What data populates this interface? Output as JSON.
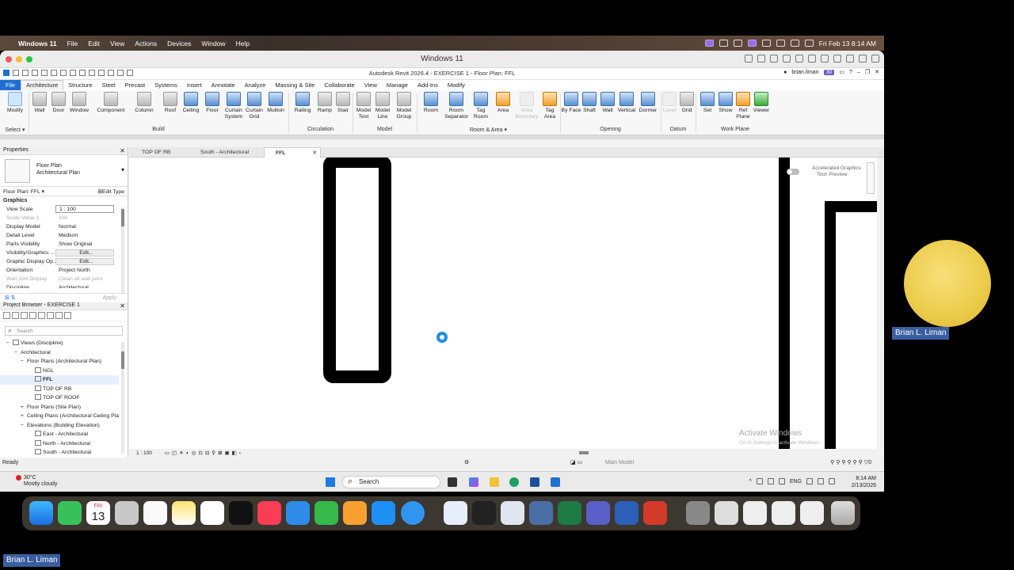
{
  "mac_menubar": {
    "app": "Windows 11",
    "items": [
      "File",
      "Edit",
      "View",
      "Actions",
      "Devices",
      "Window",
      "Help"
    ],
    "clock": "Fri Feb 13  8:14 AM"
  },
  "vm_window": {
    "title": "Windows 11"
  },
  "revit": {
    "title": "Autodesk Revit 2026.4 - EXERCISE 1 - Floor Plan: FFL",
    "user": "brian.liman",
    "badge": "30",
    "tabs": [
      "File",
      "Architecture",
      "Structure",
      "Steel",
      "Precast",
      "Systems",
      "Insert",
      "Annotate",
      "Analyze",
      "Massing & Site",
      "Collaborate",
      "View",
      "Manage",
      "Add-Ins",
      "Modify"
    ],
    "active_tab": "Architecture",
    "ribbon_buttons": [
      {
        "label": "Modify",
        "icon": "cursor-icon"
      },
      {
        "label": "Wall",
        "icon": "wall-icon"
      },
      {
        "label": "Door",
        "icon": "door-icon"
      },
      {
        "label": "Window",
        "icon": "window-icon"
      },
      {
        "label": "Component",
        "icon": "component-icon"
      },
      {
        "label": "Column",
        "icon": "column-icon"
      },
      {
        "label": "Roof",
        "icon": "roof-icon"
      },
      {
        "label": "Ceiling",
        "icon": "ceiling-icon"
      },
      {
        "label": "Floor",
        "icon": "floor-icon"
      },
      {
        "label": "Curtain System",
        "icon": "curtain-system-icon"
      },
      {
        "label": "Curtain Grid",
        "icon": "curtain-grid-icon"
      },
      {
        "label": "Mullion",
        "icon": "mullion-icon"
      },
      {
        "label": "Railing",
        "icon": "railing-icon"
      },
      {
        "label": "Ramp",
        "icon": "ramp-icon"
      },
      {
        "label": "Stair",
        "icon": "stair-icon"
      },
      {
        "label": "Model Text",
        "icon": "model-text-icon"
      },
      {
        "label": "Model Line",
        "icon": "model-line-icon"
      },
      {
        "label": "Model Group",
        "icon": "model-group-icon"
      },
      {
        "label": "Room",
        "icon": "room-icon"
      },
      {
        "label": "Room Separator",
        "icon": "room-separator-icon"
      },
      {
        "label": "Tag Room",
        "icon": "tag-room-icon"
      },
      {
        "label": "Area",
        "icon": "area-icon"
      },
      {
        "label": "Area Boundary",
        "icon": "area-boundary-icon"
      },
      {
        "label": "Tag Area",
        "icon": "tag-area-icon"
      },
      {
        "label": "By Face",
        "icon": "by-face-icon"
      },
      {
        "label": "Shaft",
        "icon": "shaft-icon"
      },
      {
        "label": "Wall",
        "icon": "wall-opening-icon"
      },
      {
        "label": "Vertical",
        "icon": "vertical-opening-icon"
      },
      {
        "label": "Dormer",
        "icon": "dormer-icon"
      },
      {
        "label": "Level",
        "icon": "level-icon"
      },
      {
        "label": "Grid",
        "icon": "grid-icon"
      },
      {
        "label": "Set",
        "icon": "set-workplane-icon"
      },
      {
        "label": "Show",
        "icon": "show-workplane-icon"
      },
      {
        "label": "Ref Plane",
        "icon": "ref-plane-icon"
      },
      {
        "label": "Viewer",
        "icon": "viewer-icon"
      }
    ],
    "panels": [
      "Select",
      "Build",
      "Circulation",
      "Model",
      "Room & Area",
      "Opening",
      "Datum",
      "Work Plane"
    ]
  },
  "properties": {
    "title": "Properties",
    "type_name": "Floor Plan",
    "type_sub": "Architectural Plan",
    "instance": "Floor Plan: FFL",
    "edit_type": "Edit Type",
    "group": "Graphics",
    "rows": [
      {
        "k": "View Scale",
        "v": "1 : 100"
      },
      {
        "k": "Scale Value    1:",
        "v": "100"
      },
      {
        "k": "Display Model",
        "v": "Normal"
      },
      {
        "k": "Detail Level",
        "v": "Medium"
      },
      {
        "k": "Parts Visibility",
        "v": "Show Original"
      },
      {
        "k": "Visibility/Graphics ...",
        "v": "Edit..."
      },
      {
        "k": "Graphic Display Op...",
        "v": "Edit..."
      },
      {
        "k": "Orientation",
        "v": "Project North"
      },
      {
        "k": "Wall Join Display",
        "v": "Clean all wall joins"
      },
      {
        "k": "Discipline",
        "v": "Architectural"
      }
    ],
    "apply": "Apply"
  },
  "project_browser": {
    "title": "Project Browser - EXERCISE 1",
    "search_placeholder": "Search",
    "items": [
      {
        "label": "Views (Discipline)",
        "indent": 0,
        "toggle": "−"
      },
      {
        "label": "Architectural",
        "indent": 1,
        "toggle": "−"
      },
      {
        "label": "Floor Plans (Architectural Plan)",
        "indent": 2,
        "toggle": "−"
      },
      {
        "label": "NGL",
        "indent": 3,
        "toggle": ""
      },
      {
        "label": "FFL",
        "indent": 3,
        "toggle": "",
        "selected": true
      },
      {
        "label": "TOP OF RB",
        "indent": 3,
        "toggle": ""
      },
      {
        "label": "TOP OF ROOF",
        "indent": 3,
        "toggle": ""
      },
      {
        "label": "Floor Plans (Site Plan)",
        "indent": 2,
        "toggle": "+"
      },
      {
        "label": "Ceiling Plans (Architectural Ceiling Pla",
        "indent": 2,
        "toggle": "+"
      },
      {
        "label": "Elevations (Building Elevation)",
        "indent": 2,
        "toggle": "−"
      },
      {
        "label": "East - Architectural",
        "indent": 3,
        "toggle": ""
      },
      {
        "label": "North - Architectural",
        "indent": 3,
        "toggle": ""
      },
      {
        "label": "South - Architectural",
        "indent": 3,
        "toggle": ""
      }
    ]
  },
  "view_tabs": [
    {
      "label": "TOP OF RB",
      "active": false
    },
    {
      "label": "South - Architectural",
      "active": false
    },
    {
      "label": "FFL",
      "active": true
    }
  ],
  "canvas": {
    "accel_line1": "Accelerated Graphics",
    "accel_line2": "Tech Preview",
    "watermark1": "Activate Windows",
    "watermark2": "Go to Settings to activate Windows."
  },
  "view_control": {
    "scale": "1 : 100"
  },
  "status": {
    "text": "Ready",
    "model": "Main Model",
    "filter": "0"
  },
  "taskbar": {
    "temp": "30°C",
    "condition": "Mostly cloudy",
    "search": "Search",
    "lang": "ENG",
    "time": "8:14 AM",
    "date": "2/13/2026"
  },
  "dock": {
    "calendar_day": "13",
    "calendar_weekday": "FRI"
  },
  "video": {
    "participant": "Brian L. Liman",
    "self": "Brian L. Liman"
  },
  "colors": {
    "accent": "#1f6fd0",
    "badge": "#6a5acd",
    "name_tag": "#3a5fa0"
  }
}
